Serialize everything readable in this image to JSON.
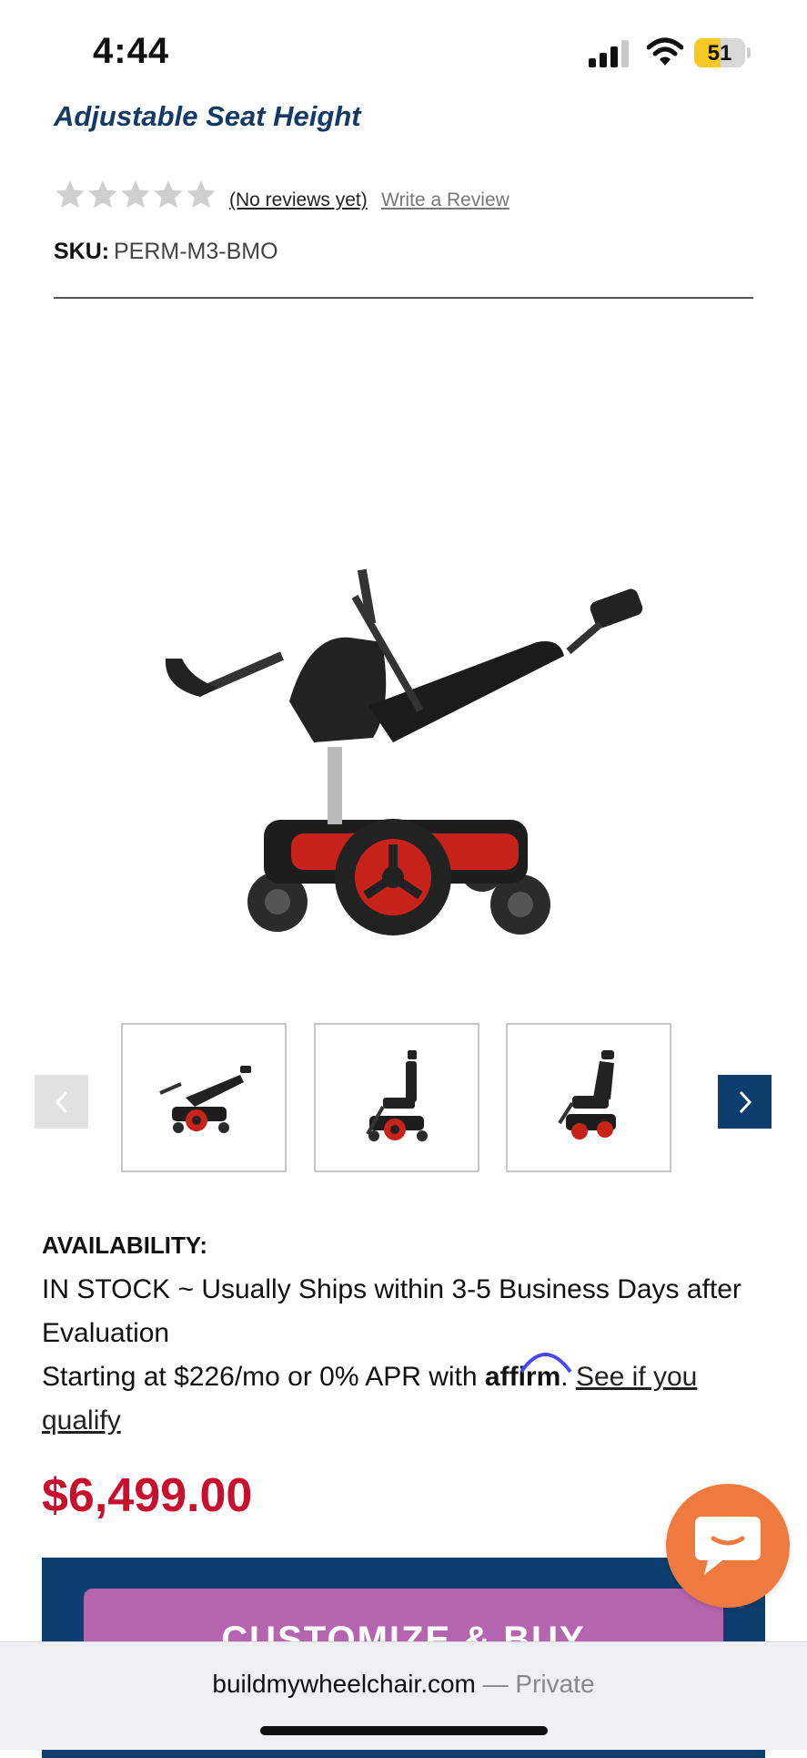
{
  "status_bar": {
    "time": "4:44",
    "battery_level": "51",
    "battery_fraction": 0.51,
    "icons": [
      "cellular-signal-icon",
      "wifi-icon",
      "battery-icon"
    ]
  },
  "product": {
    "subtitle": "Adjustable Seat Height",
    "rating": {
      "stars_filled": 0,
      "stars_total": 5
    },
    "no_reviews_label": "(No reviews yet)",
    "write_review_label": "Write a Review",
    "sku_label": "SKU:",
    "sku_value": "PERM-M3-BMO",
    "main_image_alt": "power wheelchair reclined with elevated seat",
    "thumbnails": [
      "thumbnail-reclined",
      "thumbnail-side",
      "thumbnail-angled"
    ]
  },
  "availability": {
    "label": "AVAILABILITY:",
    "text": "IN STOCK ~ Usually Ships within 3-5 Business Days after Evaluation"
  },
  "financing": {
    "prefix": "Starting at $226/mo or 0% APR with ",
    "brand": "affirm",
    "separator": ". ",
    "link": "See if you qualify"
  },
  "price": "$6,499.00",
  "buy_button_label": "CUSTOMIZE & BUY",
  "browser": {
    "domain": "buildmywheelchair.com",
    "private_label": " — Private"
  },
  "colors": {
    "brand_navy": "#0d3e6e",
    "price_red": "#c8102e",
    "buy_purple": "#b565b0",
    "chat_orange": "#ee7a40"
  }
}
